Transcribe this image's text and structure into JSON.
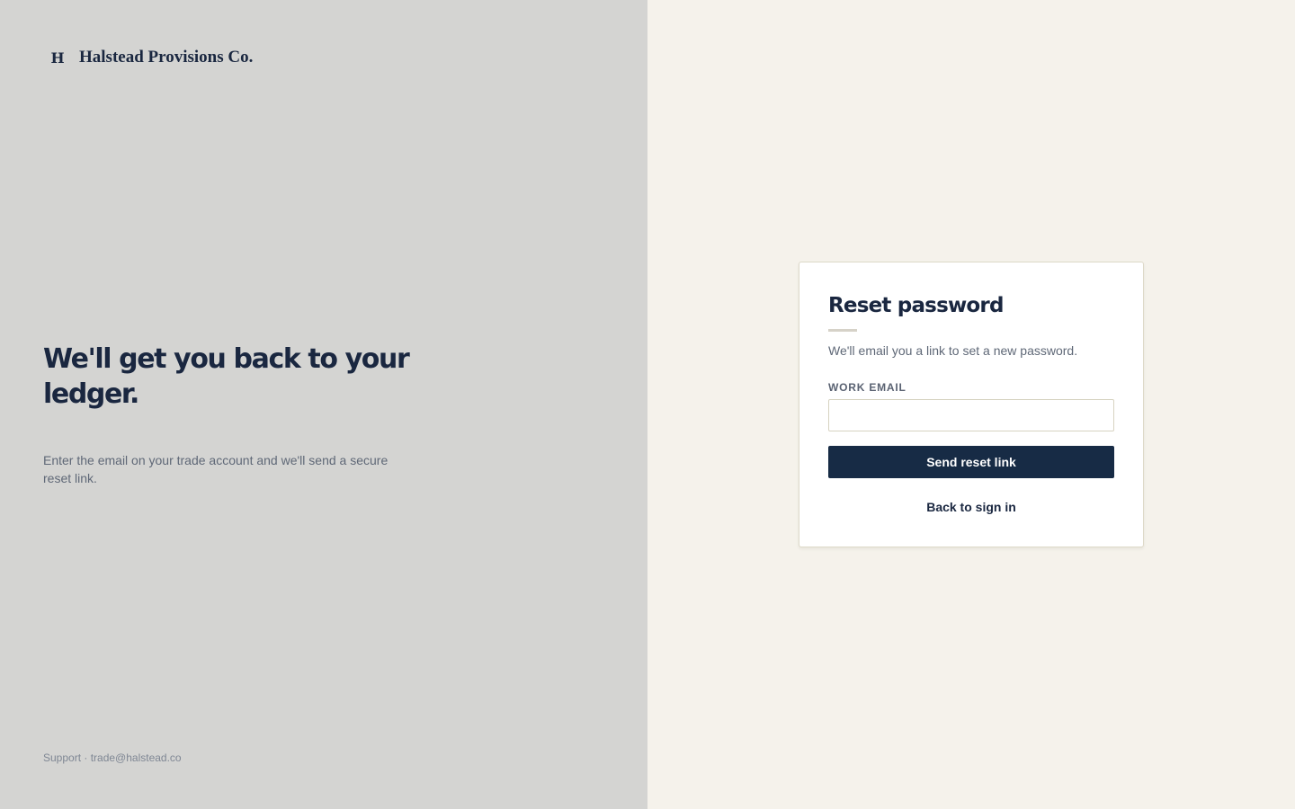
{
  "brand": {
    "mark": "H",
    "name": "Halstead Provisions Co."
  },
  "hero": {
    "title": "We'll get you back to your ledger.",
    "description": "Enter the email on your trade account and we'll send a secure reset link."
  },
  "footer": {
    "support": "Support · trade@halstead.co"
  },
  "reset_form": {
    "title": "Reset password",
    "description": "We'll email you a link to set a new password.",
    "email_label": "WORK EMAIL",
    "email_value": "",
    "email_placeholder": "",
    "submit_label": "Send reset link",
    "back_link_label": "Back to sign in"
  },
  "colors": {
    "left_panel_bg": "#d4d4d2",
    "right_panel_bg": "#f5f2eb",
    "primary": "#172b45",
    "text_dark": "#1a2740",
    "text_muted": "#5f6877"
  }
}
